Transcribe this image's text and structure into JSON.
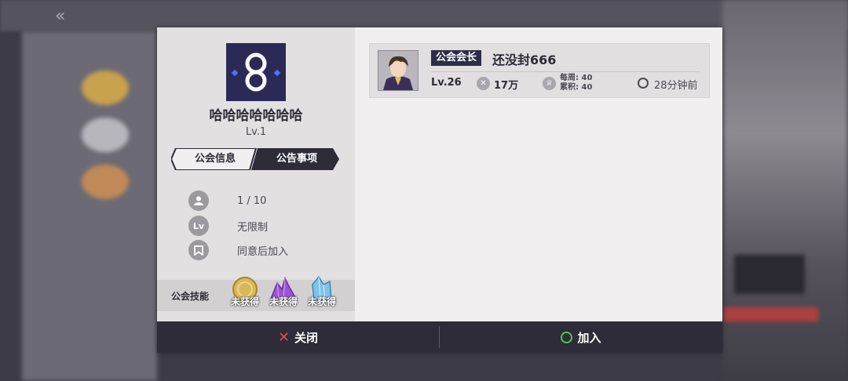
{
  "guild": {
    "name": "哈哈哈哈哈哈哈",
    "level": "Lv.1"
  },
  "tabs": {
    "info": "公会信息",
    "notice": "公告事项"
  },
  "info_rows": {
    "members": {
      "icon": "person-icon",
      "text": "1 / 10"
    },
    "level_limit": {
      "icon_text": "Lv",
      "text": "无限制"
    },
    "join_mode": {
      "icon": "bookmark-icon",
      "text": "同意后加入"
    }
  },
  "skills": {
    "label": "公会技能",
    "items": [
      {
        "icon": "gold-coin-icon",
        "status": "未获得"
      },
      {
        "icon": "purple-crystal-icon",
        "status": "未获得"
      },
      {
        "icon": "blue-crystal-icon",
        "status": "未获得"
      }
    ]
  },
  "members": [
    {
      "role": "公会会长",
      "name": "还没封666",
      "level": "Lv.26",
      "power": "17万",
      "weekly_label": "每周:",
      "weekly_value": "40",
      "total_label": "累积:",
      "total_value": "40",
      "last_online": "28分钟前"
    }
  ],
  "footer": {
    "close": "关闭",
    "join": "加入"
  },
  "colors": {
    "navy": "#2d2c38",
    "close_red": "#e24b4b",
    "join_green": "#4fc45a",
    "emblem_bg": "#2b2a57"
  }
}
